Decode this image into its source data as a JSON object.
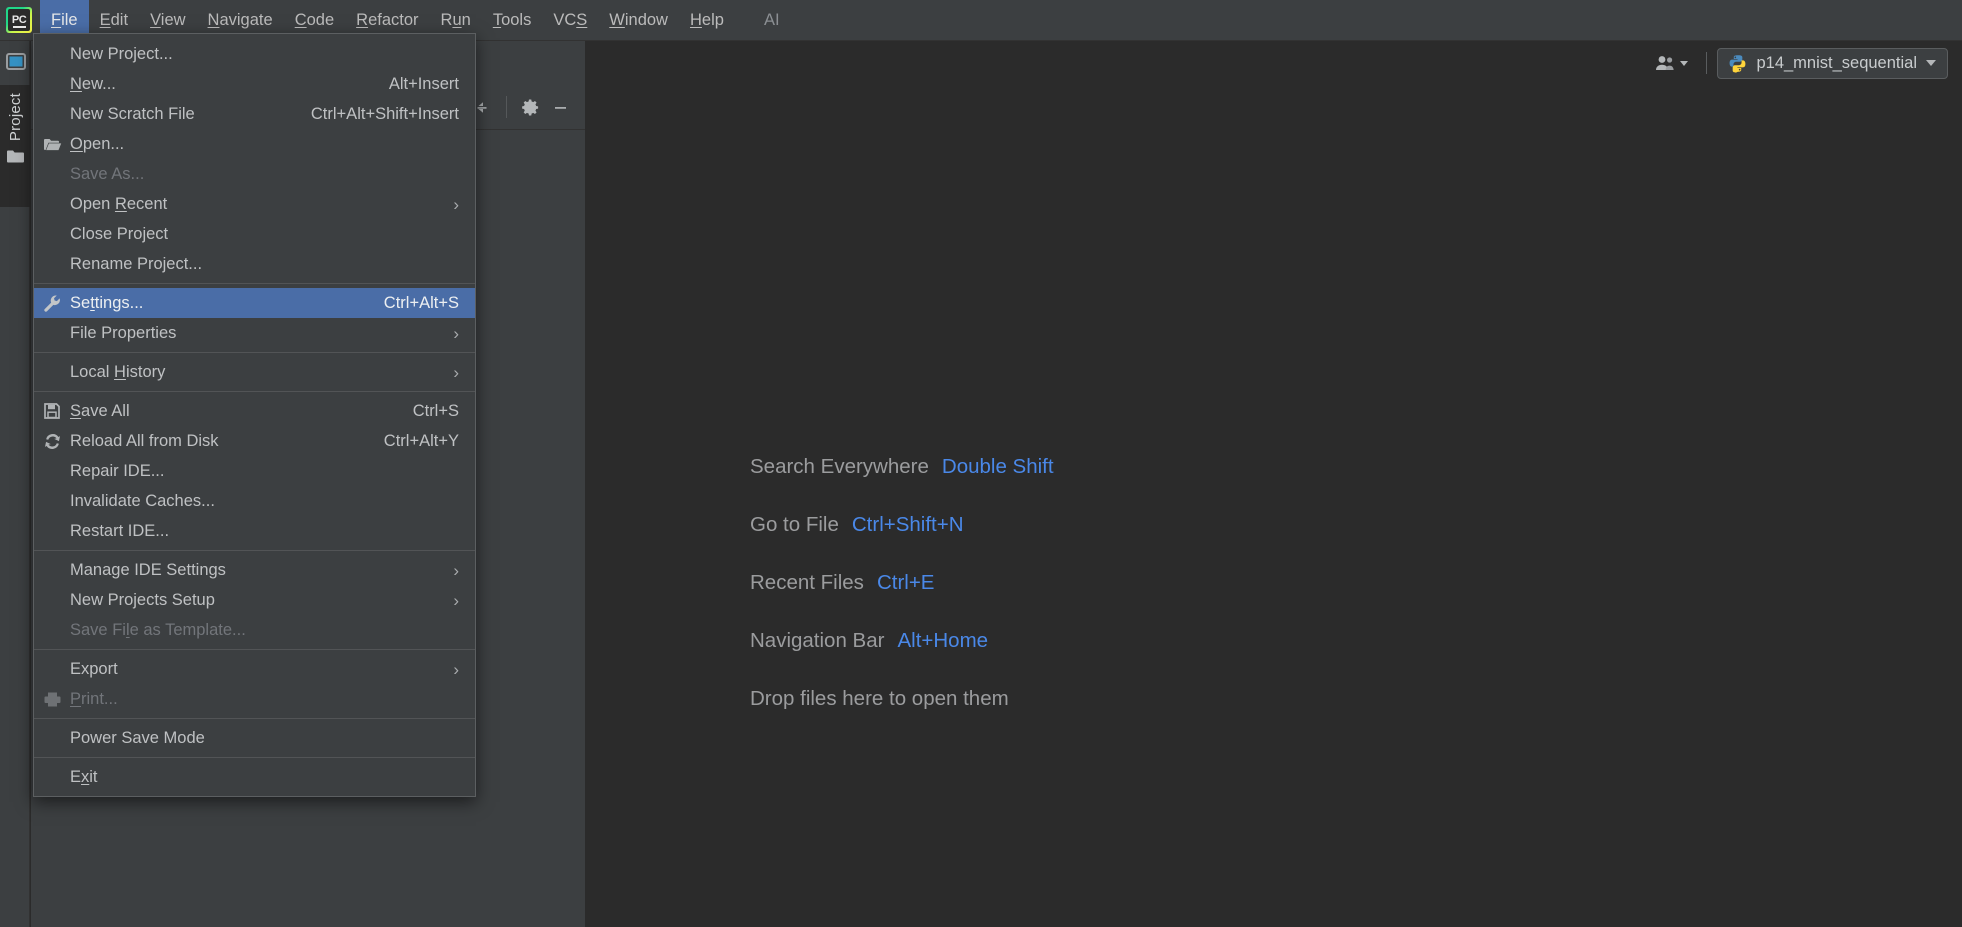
{
  "app": {
    "logo_text": "PC",
    "logo_icon": "pycharm-logo-icon"
  },
  "menubar": {
    "items": [
      {
        "label": "File",
        "mnemonic": "F",
        "active": true
      },
      {
        "label": "Edit",
        "mnemonic": "E",
        "active": false
      },
      {
        "label": "View",
        "mnemonic": "V",
        "active": false
      },
      {
        "label": "Navigate",
        "mnemonic": "N",
        "active": false
      },
      {
        "label": "Code",
        "mnemonic": "C",
        "active": false
      },
      {
        "label": "Refactor",
        "mnemonic": "R",
        "active": false
      },
      {
        "label": "Run",
        "mnemonic": "u",
        "active": false
      },
      {
        "label": "Tools",
        "mnemonic": "T",
        "active": false
      },
      {
        "label": "VCS",
        "mnemonic": "S",
        "active": false
      },
      {
        "label": "Window",
        "mnemonic": "W",
        "active": false
      },
      {
        "label": "Help",
        "mnemonic": "H",
        "active": false
      }
    ],
    "ai_label": "AI"
  },
  "toolbar": {
    "people_icon": "people-icon",
    "project_selector": {
      "label": "p14_mnist_sequential",
      "icon": "python-file-icon"
    }
  },
  "left_stripe": {
    "project_tab_label": "Project",
    "project_tab_icon": "folder-icon",
    "top_button_icon": "tool-window-icon"
  },
  "toolwindow": {
    "collapse_icon": "collapse-all-icon",
    "settings_icon": "gear-icon",
    "minimize_icon": "minimize-icon"
  },
  "editor_hints": [
    {
      "label": "Search Everywhere",
      "key": "Double Shift"
    },
    {
      "label": "Go to File",
      "key": "Ctrl+Shift+N"
    },
    {
      "label": "Recent Files",
      "key": "Ctrl+E"
    },
    {
      "label": "Navigation Bar",
      "key": "Alt+Home"
    }
  ],
  "editor_drop_text": "Drop files here to open them",
  "file_menu": {
    "groups": [
      {
        "items": [
          {
            "label": "New Project...",
            "accel": "",
            "icon": "",
            "mnemonic": "",
            "state": "normal",
            "submenu": false
          },
          {
            "label": "New...",
            "accel": "Alt+Insert",
            "icon": "",
            "mnemonic": "N",
            "state": "normal",
            "submenu": false
          },
          {
            "label": "New Scratch File",
            "accel": "Ctrl+Alt+Shift+Insert",
            "icon": "",
            "mnemonic": "",
            "state": "normal",
            "submenu": false
          },
          {
            "label": "Open...",
            "accel": "",
            "icon": "folder-open-icon",
            "mnemonic": "O",
            "state": "normal",
            "submenu": false
          },
          {
            "label": "Save As...",
            "accel": "",
            "icon": "",
            "mnemonic": "",
            "state": "disabled",
            "submenu": false
          },
          {
            "label": "Open Recent",
            "accel": "",
            "icon": "",
            "mnemonic": "R",
            "state": "normal",
            "submenu": true
          },
          {
            "label": "Close Project",
            "accel": "",
            "icon": "",
            "mnemonic": "",
            "state": "normal",
            "submenu": false
          },
          {
            "label": "Rename Project...",
            "accel": "",
            "icon": "",
            "mnemonic": "",
            "state": "normal",
            "submenu": false
          }
        ]
      },
      {
        "items": [
          {
            "label": "Settings...",
            "accel": "Ctrl+Alt+S",
            "icon": "wrench-icon",
            "mnemonic": "t",
            "state": "selected",
            "submenu": false
          },
          {
            "label": "File Properties",
            "accel": "",
            "icon": "",
            "mnemonic": "",
            "state": "normal",
            "submenu": true
          }
        ]
      },
      {
        "items": [
          {
            "label": "Local History",
            "accel": "",
            "icon": "",
            "mnemonic": "H",
            "state": "normal",
            "submenu": true
          }
        ]
      },
      {
        "items": [
          {
            "label": "Save All",
            "accel": "Ctrl+S",
            "icon": "save-icon",
            "mnemonic": "S",
            "state": "normal",
            "submenu": false
          },
          {
            "label": "Reload All from Disk",
            "accel": "Ctrl+Alt+Y",
            "icon": "reload-icon",
            "mnemonic": "",
            "state": "normal",
            "submenu": false
          },
          {
            "label": "Repair IDE...",
            "accel": "",
            "icon": "",
            "mnemonic": "",
            "state": "normal",
            "submenu": false
          },
          {
            "label": "Invalidate Caches...",
            "accel": "",
            "icon": "",
            "mnemonic": "",
            "state": "normal",
            "submenu": false
          },
          {
            "label": "Restart IDE...",
            "accel": "",
            "icon": "",
            "mnemonic": "",
            "state": "normal",
            "submenu": false
          }
        ]
      },
      {
        "items": [
          {
            "label": "Manage IDE Settings",
            "accel": "",
            "icon": "",
            "mnemonic": "",
            "state": "normal",
            "submenu": true
          },
          {
            "label": "New Projects Setup",
            "accel": "",
            "icon": "",
            "mnemonic": "",
            "state": "normal",
            "submenu": true
          },
          {
            "label": "Save File as Template...",
            "accel": "",
            "icon": "",
            "mnemonic": "l",
            "state": "disabled",
            "submenu": false
          }
        ]
      },
      {
        "items": [
          {
            "label": "Export",
            "accel": "",
            "icon": "",
            "mnemonic": "",
            "state": "normal",
            "submenu": true
          },
          {
            "label": "Print...",
            "accel": "",
            "icon": "print-icon",
            "mnemonic": "P",
            "state": "disabled",
            "submenu": false
          }
        ]
      },
      {
        "items": [
          {
            "label": "Power Save Mode",
            "accel": "",
            "icon": "",
            "mnemonic": "",
            "state": "normal",
            "submenu": false
          }
        ]
      },
      {
        "items": [
          {
            "label": "Exit",
            "accel": "",
            "icon": "",
            "mnemonic": "x",
            "state": "normal",
            "submenu": false
          }
        ]
      }
    ]
  },
  "colors": {
    "menubar_bg": "#3c3f41",
    "editor_bg": "#2b2b2b",
    "selection_blue": "#4a6da7",
    "hint_key_blue": "#4a88e8",
    "text": "#bfc1c3",
    "disabled_text": "#72757a"
  }
}
